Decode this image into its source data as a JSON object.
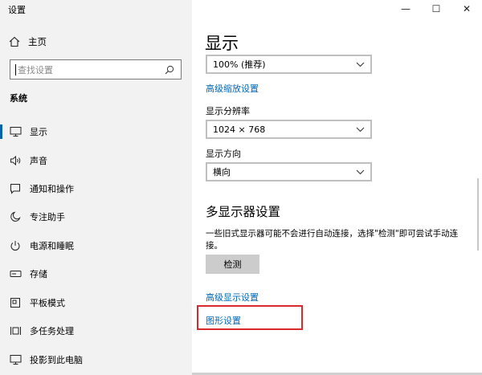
{
  "app": {
    "title": "设置"
  },
  "sidebar": {
    "home_label": "主页",
    "search_placeholder": "查找设置",
    "section_label": "系统",
    "items": [
      {
        "label": "显示",
        "icon": "monitor-icon",
        "active": true
      },
      {
        "label": "声音",
        "icon": "speaker-icon",
        "active": false
      },
      {
        "label": "通知和操作",
        "icon": "notification-icon",
        "active": false
      },
      {
        "label": "专注助手",
        "icon": "moon-icon",
        "active": false
      },
      {
        "label": "电源和睡眠",
        "icon": "power-icon",
        "active": false
      },
      {
        "label": "存储",
        "icon": "storage-icon",
        "active": false
      },
      {
        "label": "平板模式",
        "icon": "tablet-icon",
        "active": false
      },
      {
        "label": "多任务处理",
        "icon": "multitask-icon",
        "active": false
      },
      {
        "label": "投影到此电脑",
        "icon": "project-icon",
        "active": false
      }
    ]
  },
  "window_controls": {
    "minimize": "—",
    "maximize": "☐",
    "close": "✕"
  },
  "main": {
    "title": "显示",
    "scale_value": "100% (推荐)",
    "advanced_scaling_link": "高级缩放设置",
    "resolution_label": "显示分辨率",
    "resolution_value": "1024 × 768",
    "orientation_label": "显示方向",
    "orientation_value": "横向",
    "multi_display_title": "多显示器设置",
    "multi_display_desc": "一些旧式显示器可能不会进行自动连接，选择\"检测\"即可尝试手动连接。",
    "detect_button": "检测",
    "advanced_display_link": "高级显示设置",
    "graphics_link": "图形设置"
  },
  "colors": {
    "accent": "#0063b1",
    "link": "#0067b8",
    "highlight": "#d9292b"
  }
}
